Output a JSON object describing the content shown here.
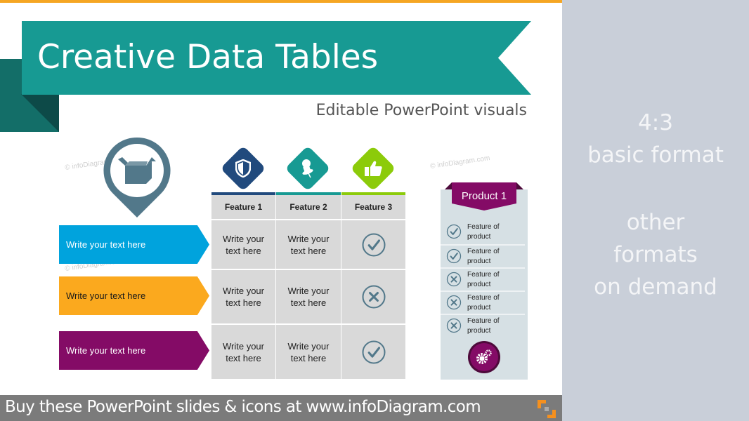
{
  "slide": {
    "title": "Creative Data Tables",
    "subtitle": "Editable PowerPoint visuals",
    "watermark": "© infoDiagram.com",
    "colors": {
      "accent_top": "#f5a623",
      "banner": "#179a93",
      "banner_dark": "#136e68"
    }
  },
  "location_pin": {
    "icon": "open-box-icon",
    "color": "#52788a"
  },
  "row_labels": [
    {
      "label": "Write your  text here",
      "color": "#00a3dd",
      "text_color": "#ffffff"
    },
    {
      "label": "Write your  text here",
      "color": "#fba91e",
      "text_color": "#1a1a1a"
    },
    {
      "label": "Write your  text here",
      "color": "#840b66",
      "text_color": "#ffffff"
    }
  ],
  "feature_table": {
    "headers": [
      {
        "label": "Feature 1",
        "icon": "shield-icon",
        "color": "#214a7d"
      },
      {
        "label": "Feature 2",
        "icon": "pushpin-icon",
        "color": "#179a93"
      },
      {
        "label": "Feature 3",
        "icon": "thumbs-up-icon",
        "color": "#8ccb0a"
      }
    ],
    "rows": [
      {
        "cells": [
          "Write your text here",
          "Write your text here"
        ],
        "status": "check"
      },
      {
        "cells": [
          "Write your text here",
          "Write your text here"
        ],
        "status": "cross"
      },
      {
        "cells": [
          "Write your text here",
          "Write your text here"
        ],
        "status": "check"
      }
    ]
  },
  "product_card": {
    "title": "Product 1",
    "color": "#840b66",
    "features": [
      {
        "label": "Feature of product",
        "status": "check"
      },
      {
        "label": "Feature of product",
        "status": "check"
      },
      {
        "label": "Feature of product",
        "status": "cross"
      },
      {
        "label": "Feature of product",
        "status": "cross"
      },
      {
        "label": "Feature of product",
        "status": "cross"
      }
    ],
    "icon": "gears-icon"
  },
  "footer": {
    "text": "Buy these PowerPoint slides & icons at www.infoDiagram.com"
  },
  "side_panel": {
    "lines": [
      "4:3",
      "basic format",
      "",
      "other",
      "formats",
      "on demand"
    ]
  }
}
